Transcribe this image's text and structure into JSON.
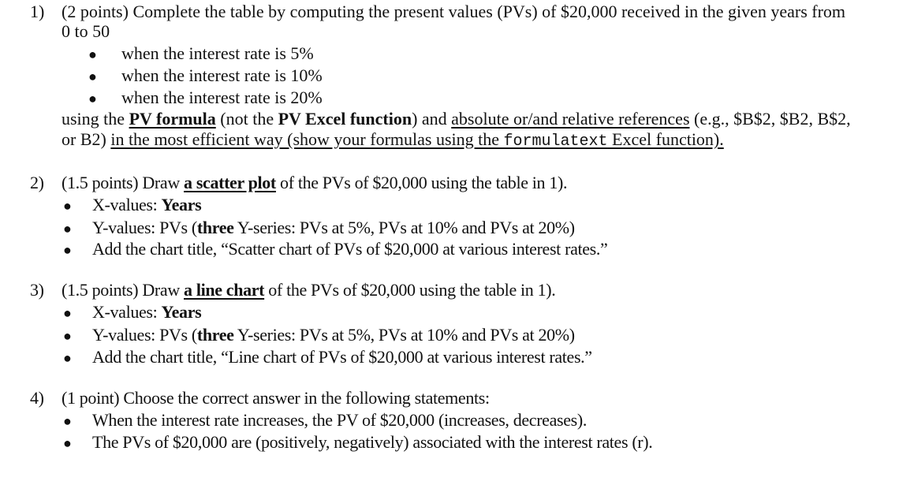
{
  "q1": {
    "number": "1)",
    "line1": "(2 points) Complete the table by computing the present values (PVs) of $20,000 received in the given years from",
    "line2": "0 to 50",
    "bullets": [
      "when the interest rate is 5%",
      "when the interest rate is 10%",
      "when the interest rate is 20%"
    ],
    "line3": {
      "t1": "using the ",
      "pv_formula": "PV formula",
      "t2": " (not the ",
      "pv_excel": "PV Excel function",
      "t3": ") and ",
      "refs": "absolute or/and relative references",
      "t4": " (e.g., $B$2, $B2, B$2,"
    },
    "line4": {
      "t1": "or B2) ",
      "u1": "in the most efficient way (show your formulas using the ",
      "mono": "formulatext",
      "u2": " Excel function)."
    }
  },
  "q2": {
    "number": "2)",
    "head": {
      "t1": "(1.5 points) Draw ",
      "link": "a scatter plot",
      "t2": " of the PVs of $20,000 using the table in 1)."
    },
    "bullets": [
      {
        "t1": "X-values: ",
        "b": "Years",
        "t2": ""
      },
      {
        "t1": "Y-values: PVs (",
        "b": "three",
        "t2": " Y-series: PVs at 5%, PVs at 10% and PVs at 20%)"
      },
      {
        "t1": "Add the chart title, “Scatter chart of PVs of $20,000 at various interest rates.”",
        "b": "",
        "t2": ""
      }
    ]
  },
  "q3": {
    "number": "3)",
    "head": {
      "t1": "(1.5 points) Draw ",
      "link": "a line chart",
      "t2": " of the PVs of $20,000 using the table in 1)."
    },
    "bullets": [
      {
        "t1": "X-values: ",
        "b": "Years",
        "t2": ""
      },
      {
        "t1": "Y-values: PVs (",
        "b": "three",
        "t2": " Y-series: PVs at 5%, PVs at 10% and PVs at 20%)"
      },
      {
        "t1": "Add the chart title, “Line chart of PVs of $20,000 at various interest rates.”",
        "b": "",
        "t2": ""
      }
    ]
  },
  "q4": {
    "number": "4)",
    "head": "(1 point) Choose the correct answer in the following statements:",
    "bullets": [
      "When the interest rate increases, the PV of $20,000 (increases, decreases).",
      "The PVs of $20,000 are (positively, negatively) associated with the interest rates (r)."
    ]
  },
  "bullet_glyph": "●"
}
